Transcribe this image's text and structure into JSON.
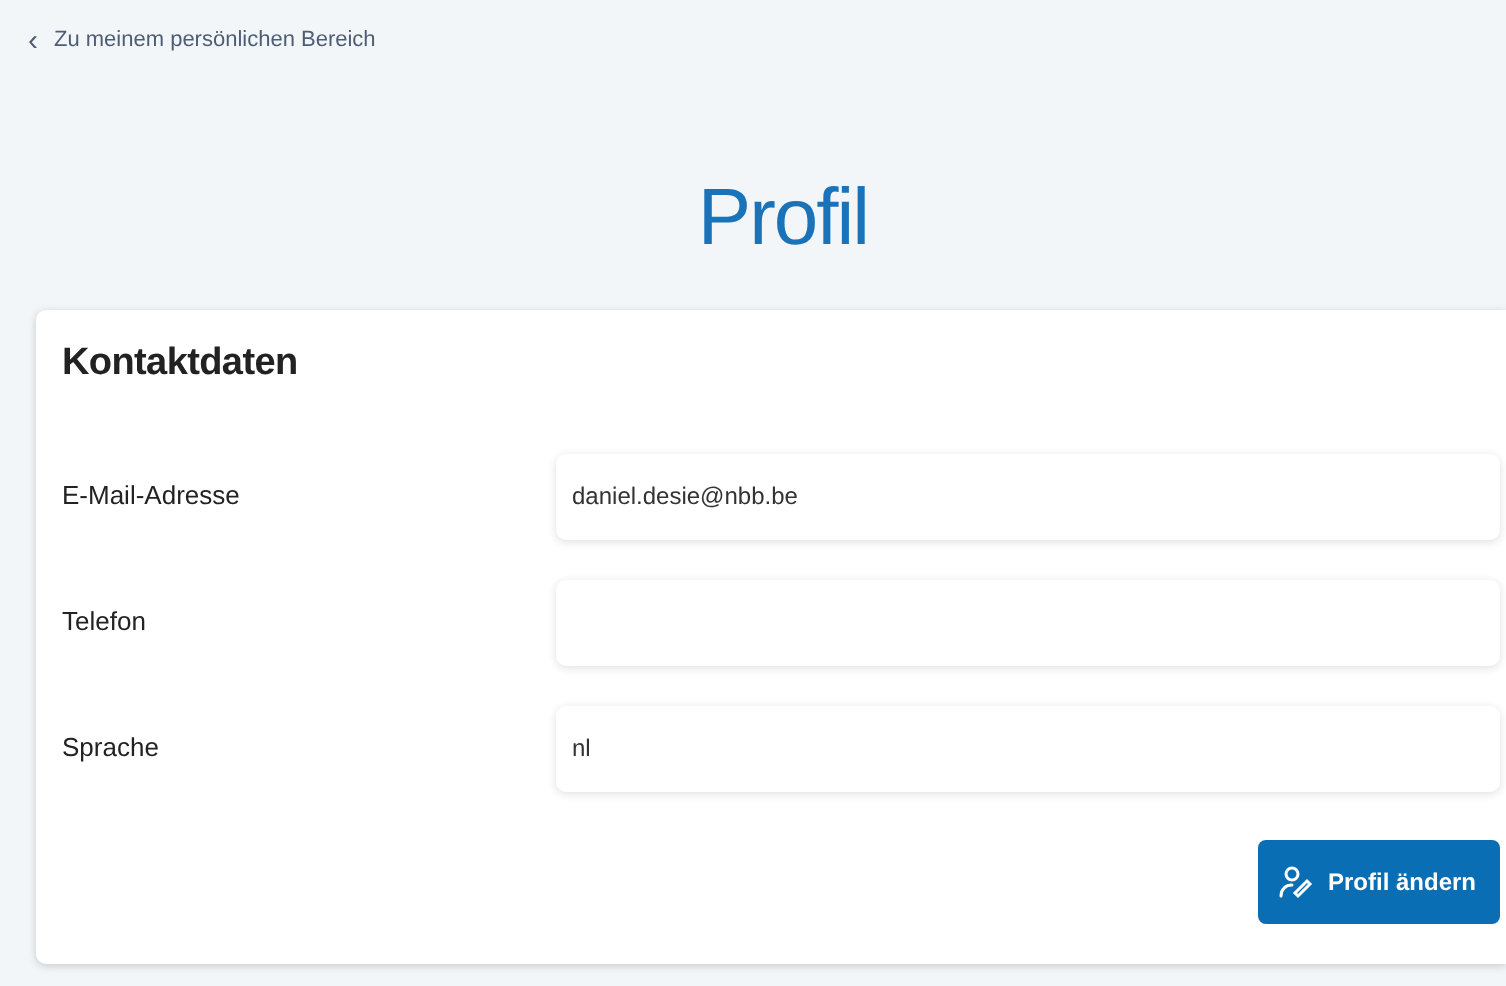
{
  "back_link": {
    "icon": "‹",
    "label": "Zu meinem persönlichen Bereich"
  },
  "page_title": "Profil",
  "card": {
    "title": "Kontaktdaten",
    "fields": [
      {
        "label": "E-Mail-Adresse",
        "value": "daniel.desie@nbb.be"
      },
      {
        "label": "Telefon"
      },
      {
        "label": "Sprache",
        "value": "nl"
      }
    ],
    "button": "Profil ändern"
  }
}
